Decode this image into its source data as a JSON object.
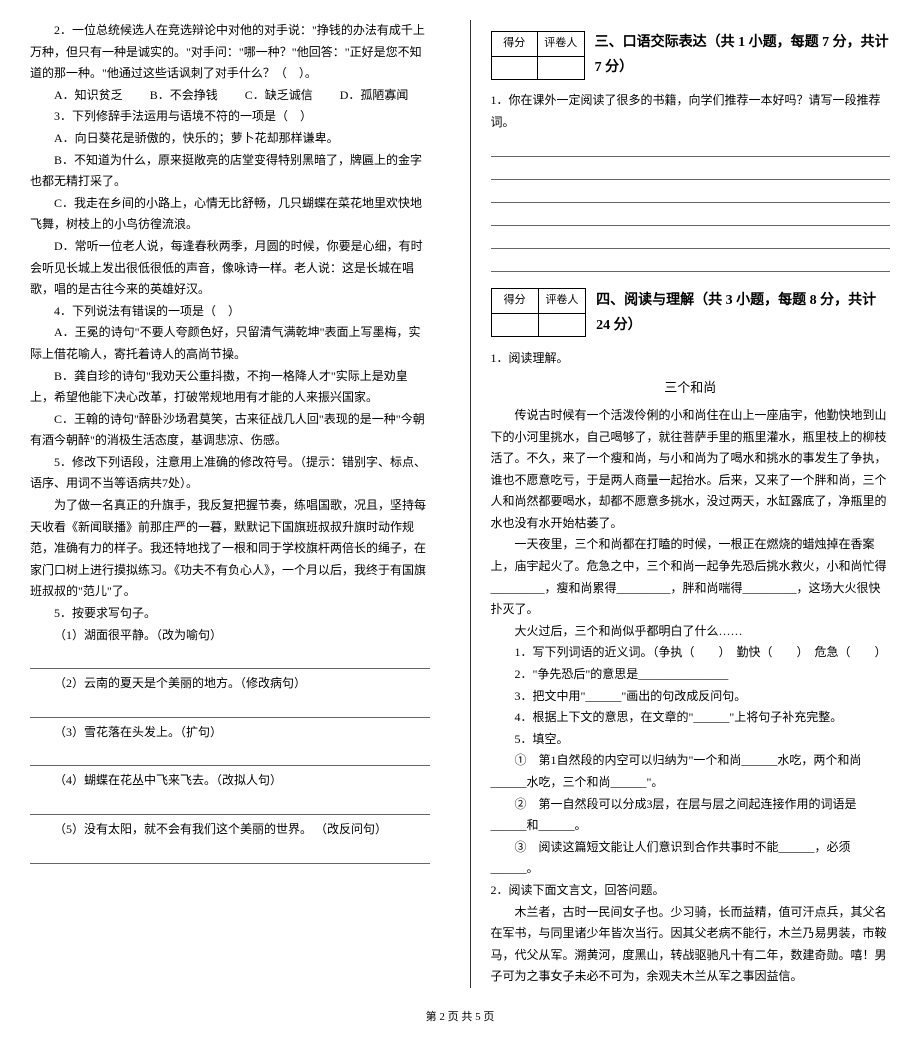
{
  "left": {
    "q2": "2．一位总统候选人在竞选辩论中对他的对手说：\"挣钱的办法有成千上万种，但只有一种是诚实的。\"对手问：\"哪一种？\"他回答：\"正好是您不知道的那一种。\"他通过这些话讽刺了对手什么？（　）。",
    "q2_A": "A．知识贫乏",
    "q2_B": "B．不会挣钱",
    "q2_C": "C．缺乏诚信",
    "q2_D": "D．孤陋寡闻",
    "q3": "3．下列修辞手法运用与语境不符的一项是（　）",
    "q3_A": "A．向日葵花是骄傲的，快乐的；萝卜花却那样谦卑。",
    "q3_B": "B．不知道为什么，原来挺敞亮的店堂变得特别黑暗了，牌匾上的金字也都无精打采了。",
    "q3_C": "C．我走在乡间的小路上，心情无比舒畅，几只蝴蝶在菜花地里欢快地飞舞，树枝上的小鸟彷徨流浪。",
    "q3_D": "D．常听一位老人说，每逢春秋两季，月圆的时候，你要是心细，有时会听见长城上发出很低很低的声音，像咏诗一样。老人说：这是长城在唱歌，唱的是古往今来的英雄好汉。",
    "q4": "4．下列说法有错误的一项是（　）",
    "q4_A": "A．王冕的诗句\"不要人夸颜色好，只留清气满乾坤\"表面上写墨梅，实际上借花喻人，寄托着诗人的高尚节操。",
    "q4_B": "B．龚自珍的诗句\"我劝天公重抖擞，不拘一格降人才\"实际上是劝皇上，希望他能下决心改革，打破常规地用有才能的人来振兴国家。",
    "q4_C": "C．王翰的诗句\"醉卧沙场君莫笑，古来征战几人回\"表现的是一种\"今朝有酒今朝醉\"的消极生活态度，基调悲凉、伤感。",
    "q5": "5．修改下列语段，注意用上准确的修改符号。（提示：错别字、标点、语序、用词不当等语病共7处）。",
    "q5_text": "为了做一名真正的升旗手，我反复把握节奏，练唱国歌，况且，坚持每天收看《新闻联播》前那庄严的一暮，默默记下国旗班叔叔升旗时动作规范，准确有力的样子。我还特地找了一根和同于学校旗杆两倍长的绳子，在家门口树上进行摸拟练习。《功夫不有负心人》，一个月以后，我终于有国旗班叔叔的\"范儿\"了。",
    "q6": "5．按要求写句子。",
    "q6_1": "（1）湖面很平静。（改为喻句）",
    "q6_2": "（2）云南的夏天是个美丽的地方。（修改病句）",
    "q6_3": "（3）雪花落在头发上。（扩句）",
    "q6_4": "（4）蝴蝶在花丛中飞来飞去。（改拟人句）",
    "q6_5": "（5）没有太阳，就不会有我们这个美丽的世界。 （改反问句）"
  },
  "score_labels": {
    "score": "得分",
    "grader": "评卷人"
  },
  "section3": {
    "title": "三、口语交际表达（共 1 小题，每题 7 分，共计 7 分）",
    "q1": "1．你在课外一定阅读了很多的书籍，向学们推荐一本好吗？请写一段推荐词。"
  },
  "section4": {
    "title": "四、阅读与理解（共 3 小题，每题 8 分，共计 24 分）",
    "q1": "1．阅读理解。",
    "article_title": "三个和尚",
    "p1": "传说古时候有一个活泼伶俐的小和尚住在山上一座庙宇，他勤快地到山下的小河里挑水，自己喝够了，就往菩萨手里的瓶里灌水，瓶里枝上的柳枝活了。不久，来了一个瘦和尚，与小和尚为了喝水和挑水的事发生了争执，谁也不愿意吃亏，于是两人商量一起抬水。后来，又来了一个胖和尚，三个人和尚然都要喝水，却都不愿意多挑水，没过两天，水缸露底了，净瓶里的水也没有水开始枯萎了。",
    "p2": "一天夜里，三个和尚都在打瞌的时候，一根正在燃烧的蜡烛掉在香案上，庙宇起火了。危急之中，三个和尚一起争先恐后挑水救火，小和尚忙得_________，瘦和尚累得_________，胖和尚喘得_________，这场大火很快扑灭了。",
    "p3": "大火过后，三个和尚似乎都明白了什么……",
    "sub1": "1．写下列词语的近义词。（争执（　　）　勤快（　　）　危急（　　）",
    "sub2": "2．\"争先恐后\"的意思是_______________",
    "sub3": "3．把文中用\"______\"画出的句改成反问句。",
    "sub4": "4．根据上下文的意思，在文章的\"______\"上将句子补充完整。",
    "sub5": "5．填空。",
    "sub5_1": "①　第1自然段的内空可以归纳为\"一个和尚______水吃，两个和尚______水吃，三个和尚______\"。",
    "sub5_2": "②　第一自然段可以分成3层，在层与层之间起连接作用的词语是______和______。",
    "sub5_3": "③　阅读这篇短文能让人们意识到合作共事时不能______，必须______。",
    "q2": "2．阅读下面文言文，回答问题。",
    "wenyan": "木兰者，古时一民间女子也。少习骑，长而益精，值可汗点兵，其父名在军书，与同里诸少年皆次当行。因其父老病不能行，木兰乃易男装，市鞍马，代父从军。溯黄河，度黑山，转战驱驰凡十有二年，数建奇勋。嘻！男子可为之事女子未必不可为，余观夫木兰从军之事因益信。"
  },
  "footer": "第 2 页  共 5 页"
}
